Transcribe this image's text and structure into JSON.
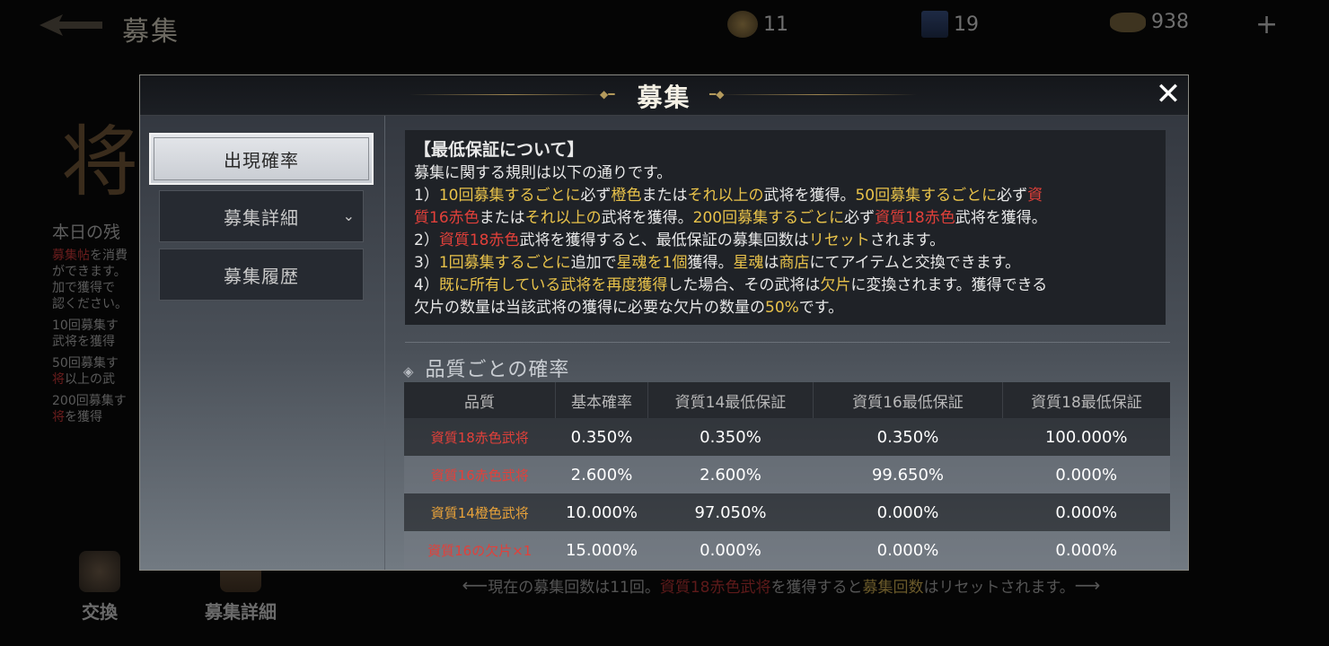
{
  "background": {
    "title": "募集",
    "resources": [
      {
        "icon": "gold-token-icon",
        "value": "11"
      },
      {
        "icon": "banner-icon",
        "value": "19"
      },
      {
        "icon": "ingot-icon",
        "value": "938"
      }
    ],
    "plus": "+",
    "big_char": "将",
    "remaining_label": "本日の残",
    "notes": [
      {
        "parts": [
          {
            "t": "募集帖",
            "c": "r"
          },
          {
            "t": "を消費"
          }
        ]
      },
      {
        "parts": [
          {
            "t": "ができます。"
          }
        ]
      },
      {
        "parts": [
          {
            "t": "加で獲得で"
          }
        ]
      },
      {
        "parts": [
          {
            "t": "認ください。"
          }
        ]
      },
      {
        "parts": [
          {
            "t": "10回募集す"
          }
        ]
      },
      {
        "parts": [
          {
            "t": "武将を獲得"
          }
        ]
      },
      {
        "parts": [
          {
            "t": "50回募集す"
          }
        ]
      },
      {
        "parts": [
          {
            "t": "将",
            "c": "r"
          },
          {
            "t": "以上の武"
          }
        ]
      },
      {
        "parts": [
          {
            "t": "200回募集す"
          }
        ]
      },
      {
        "parts": [
          {
            "t": "将",
            "c": "r"
          },
          {
            "t": "を獲得"
          }
        ]
      }
    ],
    "bottom_items": [
      "交換",
      "募集詳細"
    ],
    "banner": {
      "pre": "現在の募集回数は11回。",
      "red": "資質18赤色武将",
      "mid": "を獲得すると",
      "yellow": "募集回数",
      "post": "はリセットされます。"
    }
  },
  "modal": {
    "title": "募集",
    "close_icon": "close-x-icon",
    "tabs": [
      {
        "label": "出現確率",
        "active": true
      },
      {
        "label": "募集詳細",
        "has_chevron": true
      },
      {
        "label": "募集履歴"
      }
    ],
    "rules": {
      "heading": "【最低保証について】",
      "lines": [
        [
          {
            "t": "募集に関する規則は以下の通りです。"
          }
        ],
        [
          {
            "t": "1）"
          },
          {
            "t": "10回募集するごとに",
            "c": "y"
          },
          {
            "t": "必ず"
          },
          {
            "t": "橙色",
            "c": "y"
          },
          {
            "t": "または"
          },
          {
            "t": "それ以上の",
            "c": "y"
          },
          {
            "t": "武将を獲得。"
          },
          {
            "t": "50回募集するごとに",
            "c": "y"
          },
          {
            "t": "必ず"
          },
          {
            "t": "資",
            "c": "r"
          }
        ],
        [
          {
            "t": "質16赤色",
            "c": "r"
          },
          {
            "t": "または"
          },
          {
            "t": "それ以上の",
            "c": "y"
          },
          {
            "t": "武将を獲得。"
          },
          {
            "t": "200回募集するごとに",
            "c": "y"
          },
          {
            "t": "必ず"
          },
          {
            "t": "資質18赤色",
            "c": "r"
          },
          {
            "t": "武将を獲得。"
          }
        ],
        [
          {
            "t": "2）"
          },
          {
            "t": "資質18赤色",
            "c": "r"
          },
          {
            "t": "武将を獲得すると、最低保証の募集回数は"
          },
          {
            "t": "リセット",
            "c": "y"
          },
          {
            "t": "されます。"
          }
        ],
        [
          {
            "t": "3）"
          },
          {
            "t": "1回募集するごとに",
            "c": "y"
          },
          {
            "t": "追加で"
          },
          {
            "t": "星魂を1個",
            "c": "y"
          },
          {
            "t": "獲得。"
          },
          {
            "t": "星魂",
            "c": "y"
          },
          {
            "t": "は"
          },
          {
            "t": "商店",
            "c": "y"
          },
          {
            "t": "にてアイテムと交換できます。"
          }
        ],
        [
          {
            "t": "4）"
          },
          {
            "t": "既に所有している武将を再度獲得",
            "c": "y"
          },
          {
            "t": "した場合、その武将は"
          },
          {
            "t": "欠片",
            "c": "y"
          },
          {
            "t": "に変換されます。獲得できる"
          }
        ],
        [
          {
            "t": "欠片の数量は当該武将の獲得に必要な欠片の数量の"
          },
          {
            "t": "50%",
            "c": "y"
          },
          {
            "t": "です。"
          }
        ]
      ]
    },
    "quality_section": {
      "title": "品質ごとの確率",
      "headers": [
        "品質",
        "基本確率",
        "資質14最低保証",
        "資質16最低保証",
        "資質18最低保証"
      ],
      "rows": [
        {
          "quality": "資質18赤色武将",
          "color": "#e2403a",
          "values": [
            "0.350%",
            "0.350%",
            "0.350%",
            "100.000%"
          ]
        },
        {
          "quality": "資質16赤色武将",
          "color": "#e2403a",
          "values": [
            "2.600%",
            "2.600%",
            "99.650%",
            "0.000%"
          ]
        },
        {
          "quality": "資質14橙色武将",
          "color": "#e8a23a",
          "values": [
            "10.000%",
            "97.050%",
            "0.000%",
            "0.000%"
          ]
        },
        {
          "quality": "資質16の欠片×1",
          "color": "#e2403a",
          "values": [
            "15.000%",
            "0.000%",
            "0.000%",
            "0.000%"
          ]
        }
      ]
    }
  }
}
